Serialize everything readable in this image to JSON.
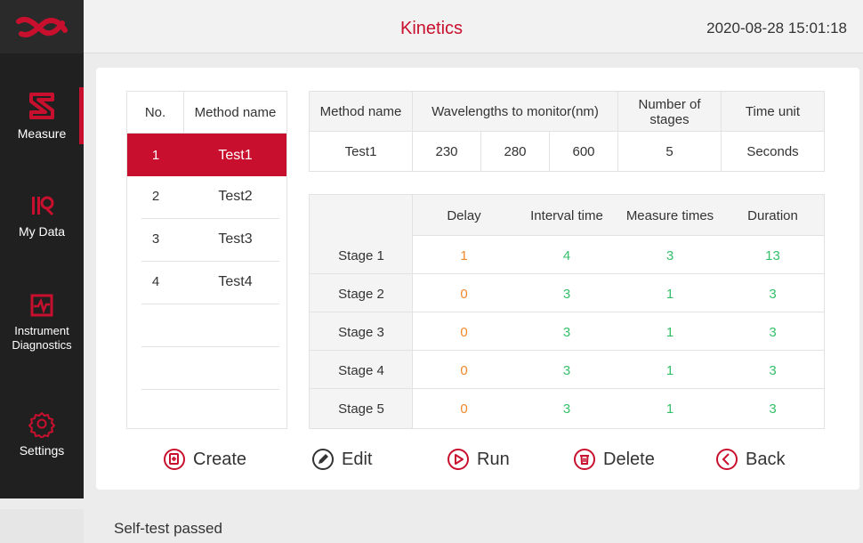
{
  "header": {
    "title": "Kinetics",
    "datetime": "2020-08-28 15:01:18"
  },
  "sidebar": {
    "items": [
      {
        "label": "Measure",
        "icon": "measure-icon",
        "active": true
      },
      {
        "label": "My Data",
        "icon": "my-data-icon",
        "active": false
      },
      {
        "label": "Instrument Diagnostics",
        "icon": "diagnostics-icon",
        "active": false
      },
      {
        "label": "Settings",
        "icon": "gear-icon",
        "active": false
      }
    ]
  },
  "method_list": {
    "headers": {
      "no": "No.",
      "name": "Method name"
    },
    "rows": [
      {
        "no": "1",
        "name": "Test1",
        "selected": true
      },
      {
        "no": "2",
        "name": "Test2",
        "selected": false
      },
      {
        "no": "3",
        "name": "Test3",
        "selected": false
      },
      {
        "no": "4",
        "name": "Test4",
        "selected": false
      }
    ]
  },
  "summary": {
    "headers": {
      "method_name": "Method name",
      "wavelengths": "Wavelengths to monitor(nm)",
      "stages": "Number of stages",
      "time_unit": "Time unit"
    },
    "values": {
      "method_name": "Test1",
      "wl1": "230",
      "wl2": "280",
      "wl3": "600",
      "stages": "5",
      "time_unit": "Seconds"
    }
  },
  "stages": {
    "headers": {
      "delay": "Delay",
      "interval": "Interval time",
      "measure_times": "Measure times",
      "duration": "Duration"
    },
    "rows": [
      {
        "label": "Stage 1",
        "delay": "1",
        "interval": "4",
        "measure_times": "3",
        "duration": "13"
      },
      {
        "label": "Stage 2",
        "delay": "0",
        "interval": "3",
        "measure_times": "1",
        "duration": "3"
      },
      {
        "label": "Stage 3",
        "delay": "0",
        "interval": "3",
        "measure_times": "1",
        "duration": "3"
      },
      {
        "label": "Stage 4",
        "delay": "0",
        "interval": "3",
        "measure_times": "1",
        "duration": "3"
      },
      {
        "label": "Stage 5",
        "delay": "0",
        "interval": "3",
        "measure_times": "1",
        "duration": "3"
      }
    ]
  },
  "actions": {
    "create": "Create",
    "edit": "Edit",
    "run": "Run",
    "delete": "Delete",
    "back": "Back"
  },
  "status": {
    "text": "Self-test passed"
  },
  "colors": {
    "accent": "#c8102e",
    "delay": "#f0882a",
    "value": "#34c06a",
    "sidebar": "#202020"
  }
}
